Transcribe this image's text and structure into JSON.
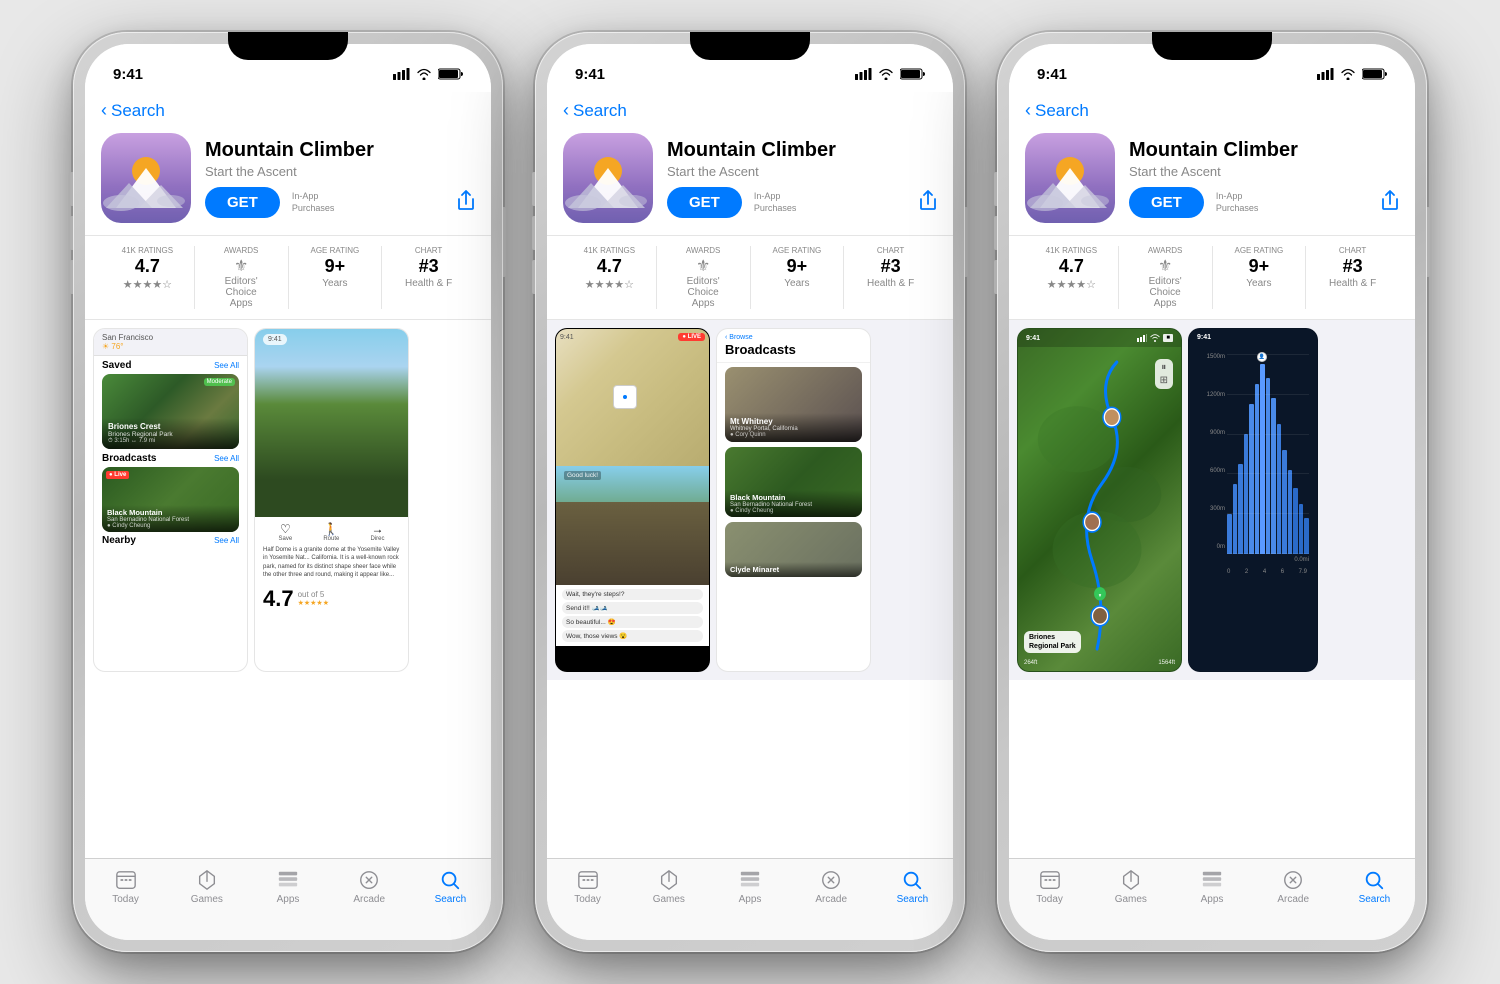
{
  "page": {
    "background": "#e8e8e8"
  },
  "phones": [
    {
      "id": "phone-1",
      "status": {
        "time": "9:41",
        "signal": "●●●●",
        "wifi": "wifi",
        "battery": "battery"
      },
      "nav": {
        "back_label": "Search"
      },
      "app": {
        "name": "Mountain Climber",
        "subtitle": "Start the Ascent",
        "get_label": "GET",
        "in_app_line1": "In-App",
        "in_app_line2": "Purchases"
      },
      "ratings": {
        "count_label": "41K RATINGS",
        "count_value": "4.7",
        "awards_label": "AWARDS",
        "awards_value": "Editors'",
        "awards_sub": "Choice",
        "age_label": "AGE RATING",
        "age_value": "9+",
        "age_sub": "Years",
        "chart_label": "CHART",
        "chart_value": "#3",
        "chart_sub": "Health & F"
      },
      "screen_content": "trails_list",
      "tabs": [
        "Today",
        "Games",
        "Apps",
        "Arcade",
        "Search"
      ],
      "active_tab": 4
    },
    {
      "id": "phone-2",
      "status": {
        "time": "9:41"
      },
      "nav": {
        "back_label": "Search"
      },
      "app": {
        "name": "Mountain Climber",
        "subtitle": "Start the Ascent",
        "get_label": "GET",
        "in_app_line1": "In-App",
        "in_app_line2": "Purchases"
      },
      "ratings": {
        "count_label": "41K RATINGS",
        "count_value": "4.7",
        "awards_label": "AWARDS",
        "awards_value": "Editors'",
        "age_label": "AGE RATING",
        "age_value": "9+",
        "age_sub": "Years",
        "chart_label": "CHART",
        "chart_value": "#3",
        "chart_sub": "Health & F"
      },
      "screen_content": "live_broadcast",
      "tabs": [
        "Today",
        "Games",
        "Apps",
        "Arcade",
        "Search"
      ],
      "active_tab": 4
    },
    {
      "id": "phone-3",
      "status": {
        "time": "9:41"
      },
      "nav": {
        "back_label": "Search"
      },
      "app": {
        "name": "Mountain Climber",
        "subtitle": "Start the Ascent",
        "get_label": "GET",
        "in_app_line1": "In-App",
        "in_app_line2": "Purchases"
      },
      "ratings": {
        "count_label": "41K RATINGS",
        "count_value": "4.7",
        "awards_label": "AWARDS",
        "awards_value": "Editors'",
        "age_label": "AGE RATING",
        "age_value": "9+",
        "age_sub": "Years",
        "chart_label": "CHART",
        "chart_value": "#3",
        "chart_sub": "Health & F"
      },
      "screen_content": "map_view",
      "tabs": [
        "Today",
        "Games",
        "Apps",
        "Arcade",
        "Search"
      ],
      "active_tab": 4
    }
  ],
  "trails": {
    "briones_crest": {
      "name": "Briones Crest",
      "park": "Briones Regional Park",
      "duration": "3:15h",
      "distance": "7.9 mi"
    },
    "black_mountain": {
      "name": "Black Mountain",
      "park": "San Bernadino National Forest",
      "user": "Cindy Cheung"
    },
    "mt_whitney": {
      "name": "Mt Whitney",
      "location": "Whitney Portal, California",
      "user": "Cory Quinn"
    },
    "clyde_minaret": {
      "name": "Clyde Minaret"
    }
  },
  "icons": {
    "today": "📋",
    "games": "🚀",
    "apps": "📚",
    "arcade": "🕹️",
    "search": "🔍",
    "back_chevron": "‹",
    "share": "⬆",
    "star": "★"
  }
}
